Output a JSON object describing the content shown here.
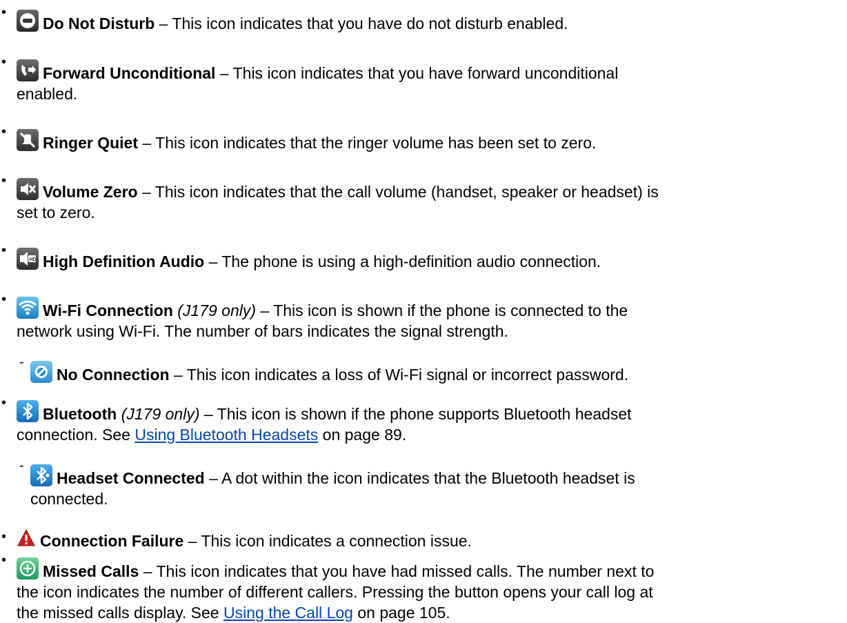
{
  "items": [
    {
      "icon": "do-not-disturb-icon",
      "title": "Do Not Disturb",
      "text": " – This icon indicates that you have do not disturb enabled."
    },
    {
      "icon": "forward-unconditional-icon",
      "title": "Forward Unconditional",
      "text_line1": " – This icon indicates that you have forward unconditional",
      "text_line2": "enabled."
    },
    {
      "icon": "ringer-quiet-icon",
      "title": "Ringer Quiet",
      "text": " – This icon indicates that the ringer volume has been set to zero."
    },
    {
      "icon": "volume-zero-icon",
      "title": "Volume Zero",
      "text_line1": " – This icon indicates that the call volume (handset, speaker or headset) is",
      "text_line2": "set to zero."
    },
    {
      "icon": "hd-audio-icon",
      "title": "High Definition Audio",
      "text": " – The phone is using a high-definition audio connection."
    },
    {
      "icon": "wifi-icon",
      "title": "Wi-Fi Connection",
      "note": "(J179 only)",
      "text_line1": " – This icon is shown if the phone is connected to the",
      "text_line2": "network using Wi-Fi. The number of bars indicates the signal strength."
    },
    {
      "icon": "no-connection-icon",
      "title": "No Connection",
      "text": " – This icon indicates a loss of Wi-Fi signal or incorrect password."
    },
    {
      "icon": "bluetooth-icon",
      "title": "Bluetooth",
      "note": "(J179 only)",
      "text_line1": " – This icon is shown if the phone supports Bluetooth headset",
      "text_line2_pre": "connection. See ",
      "link": "Using Bluetooth Headsets",
      "text_line2_post": " on page 89."
    },
    {
      "icon": "headset-connected-icon",
      "title": "Headset Connected",
      "text_line1": " – A dot within the icon indicates that the Bluetooth headset is",
      "text_line2": "connected."
    },
    {
      "icon": "connection-failure-icon",
      "title": "Connection Failure",
      "text": " – This icon indicates a connection issue."
    },
    {
      "icon": "missed-calls-icon",
      "title": "Missed Calls",
      "text_line1": " – This icon indicates that you have had missed calls. The number next to",
      "text_line2": "the icon indicates the number of different callers. Pressing the button opens your call log at",
      "text_line3_pre": "the missed calls display. See ",
      "link": "Using the Call Log",
      "text_line3_post": " on page 105."
    }
  ],
  "markers": {
    "bullet": "•",
    "dash": "-"
  },
  "colors": {
    "link": "#0645ad",
    "text": "#000000"
  }
}
